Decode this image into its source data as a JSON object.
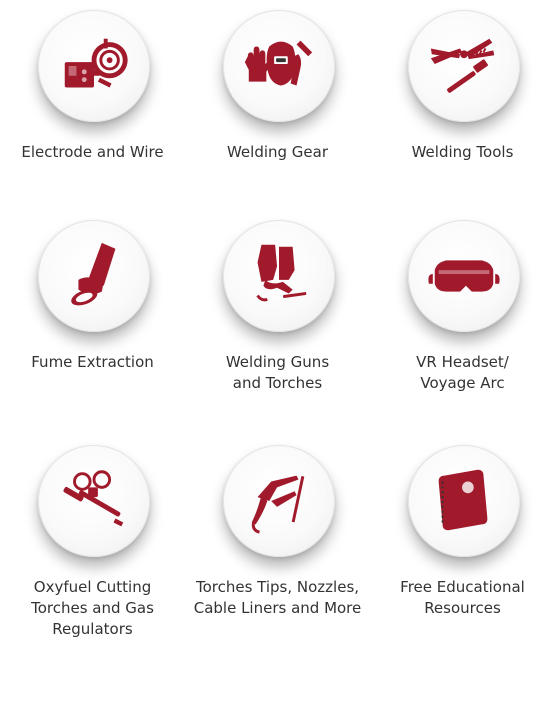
{
  "brand": {
    "accent": "#a11a2b",
    "text": "#333333"
  },
  "categories": [
    {
      "label": "Electrode and Wire",
      "icon": "wire-feeder-icon"
    },
    {
      "label": "Welding Gear",
      "icon": "welding-gear-icon"
    },
    {
      "label": "Welding Tools",
      "icon": "pliers-brush-icon"
    },
    {
      "label": "Fume Extraction",
      "icon": "fume-extraction-hose-icon"
    },
    {
      "label": "Welding Guns\nand Torches",
      "icon": "welding-gun-icon"
    },
    {
      "label": "VR Headset/\nVoyage Arc",
      "icon": "vr-headset-icon"
    },
    {
      "label": "Oxyfuel Cutting\nTorches and Gas\nRegulators",
      "icon": "oxyfuel-torch-regulator-icon"
    },
    {
      "label": "Torches Tips, Nozzles,\nCable Liners and More",
      "icon": "electrode-holder-icon"
    },
    {
      "label": "Free Educational\nResources",
      "icon": "book-icon"
    }
  ]
}
